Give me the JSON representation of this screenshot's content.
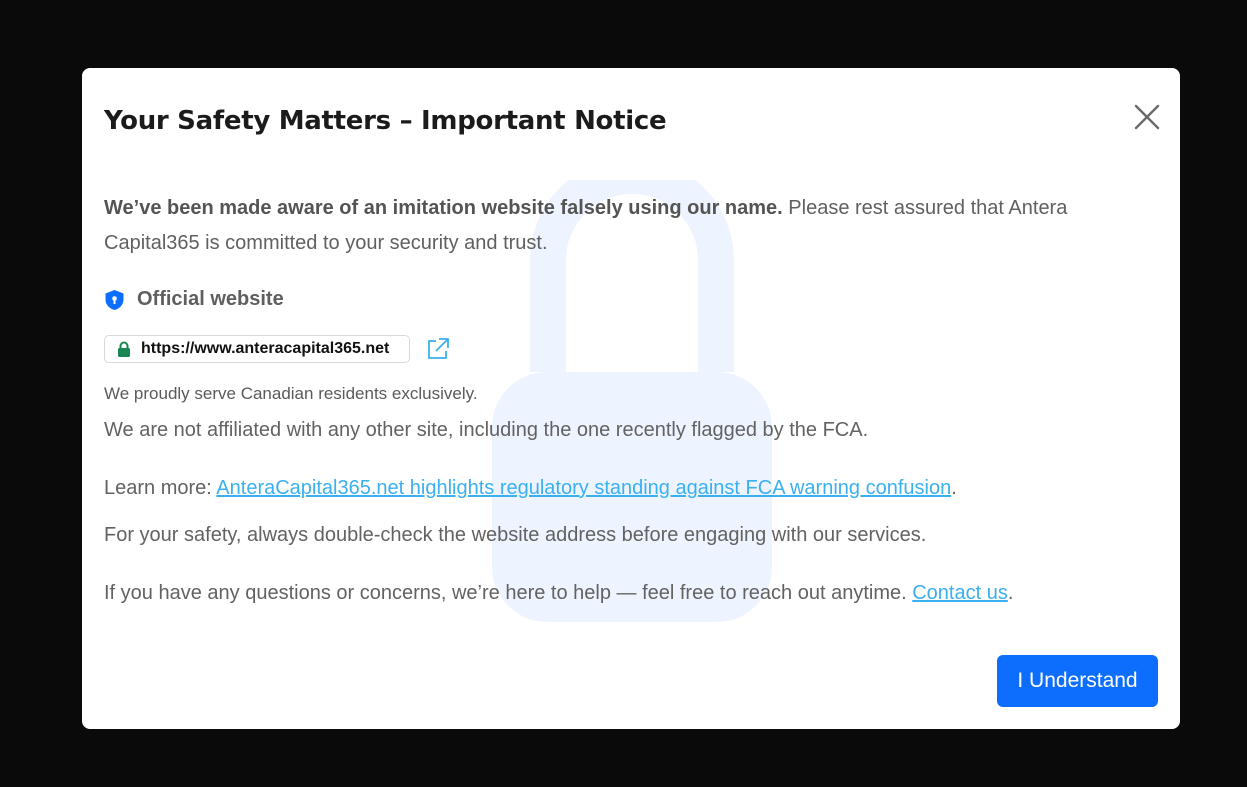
{
  "modal": {
    "title": "Your Safety Matters – Important Notice",
    "intro_bold": "We’ve been made aware of an imitation website falsely using our name.",
    "intro_rest": " Please rest assured that Antera Capital365 is committed to your security and trust.",
    "official_label": "Official website",
    "official_url": "https://www.anteracapital365.net",
    "residents_note": "We proudly serve Canadian residents exclusively.",
    "not_affiliated": "We are not affiliated with any other site, including the one recently flagged by the FCA.",
    "learn_more_prefix": "Learn more: ",
    "learn_more_link": "AnteraCapital365.net highlights regulatory standing against FCA warning confusion",
    "learn_more_suffix": ".",
    "safety_note": "For your safety, always double-check the website address before engaging with our services.",
    "questions_text": "If you have any questions or concerns, we’re here to help — feel free to reach out anytime. ",
    "contact_link": "Contact us",
    "contact_suffix": ".",
    "understand_button": "I Understand"
  },
  "icons": {
    "close": "close-icon",
    "shield": "shield-icon",
    "padlock": "padlock-icon",
    "external_link": "external-link-icon",
    "background_lock": "background-lock-icon"
  },
  "colors": {
    "backdrop": "#0a0a0a",
    "primary_button": "#0d6efd",
    "link": "#3bb0ef",
    "shield": "#0d6efd",
    "padlock": "#198754",
    "watermark": "#eef4ff"
  }
}
